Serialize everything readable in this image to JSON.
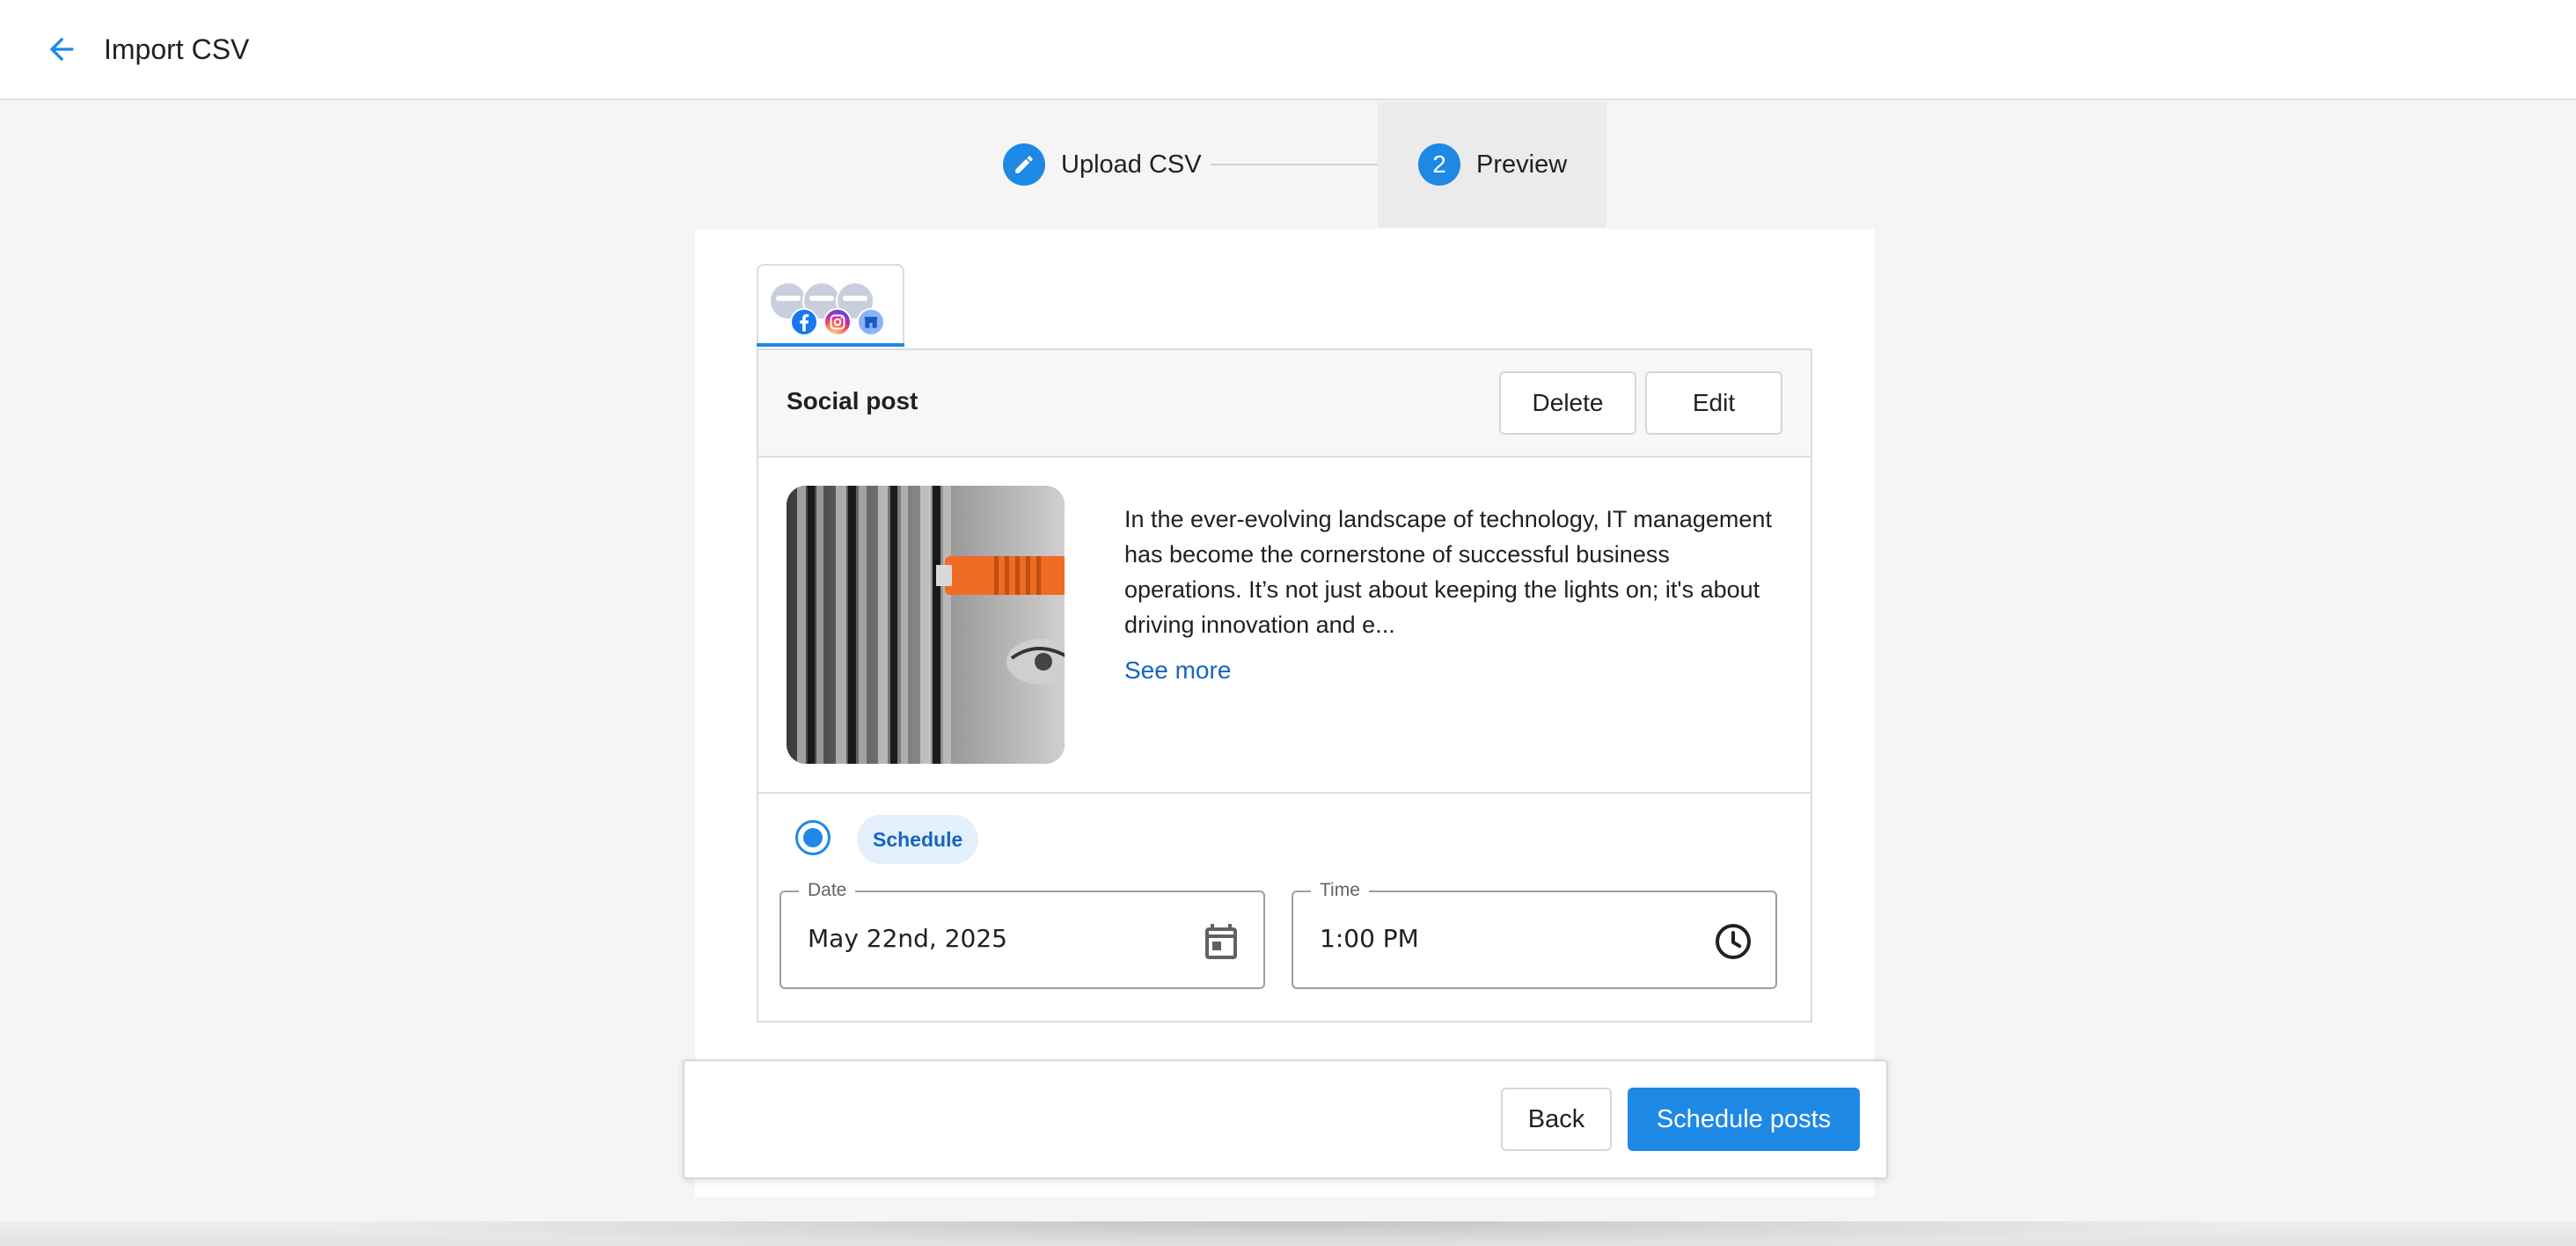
{
  "appbar": {
    "title": "Import CSV",
    "back_icon": "arrow-left-icon"
  },
  "stepper": {
    "steps": [
      {
        "label": "Upload CSV",
        "icon": "pencil-icon",
        "state": "completed"
      },
      {
        "label": "Preview",
        "number": "2",
        "state": "active"
      }
    ]
  },
  "networks": {
    "badges": [
      "facebook-icon",
      "instagram-icon",
      "google-business-icon"
    ]
  },
  "post": {
    "title": "Social post",
    "delete_label": "Delete",
    "edit_label": "Edit",
    "text": "In the ever-evolving landscape of technology, IT management has become the cornerstone of successful business operations. It’s not just about keeping the lights on; it's about driving innovation and e...",
    "see_more_label": "See more",
    "schedule_chip": "Schedule",
    "date_label": "Date",
    "date_value": "May 22nd, 2025",
    "time_label": "Time",
    "time_value": "1:00 PM"
  },
  "footer": {
    "back_label": "Back",
    "primary_label": "Schedule posts"
  },
  "colors": {
    "accent": "#1e88e5",
    "link": "#1565c0",
    "chip_bg": "#e3f0fc"
  }
}
